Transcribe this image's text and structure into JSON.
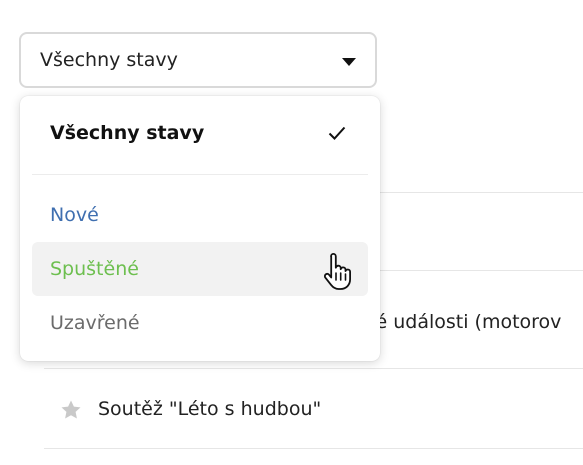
{
  "select": {
    "value": "Všechny stavy",
    "caret_icon": "caret-down-icon"
  },
  "dropdown": {
    "header": "Všechny stavy",
    "header_icon": "checkmark-icon",
    "options": [
      {
        "label": "Nové",
        "color": "#3f6fb0"
      },
      {
        "label": "Spuštěné",
        "color": "#6dbf4f",
        "hovered": true
      },
      {
        "label": "Uzavřené",
        "color": "#6b6b6b"
      }
    ]
  },
  "list": {
    "rows": [
      {
        "text": "tné události (motorov"
      },
      {
        "text": "Soutěž \"Léto s hudbou\"",
        "icon": "star-icon"
      }
    ]
  },
  "colors": {
    "accent_new": "#3f6fb0",
    "accent_running": "#6dbf4f",
    "closed": "#6b6b6b"
  }
}
